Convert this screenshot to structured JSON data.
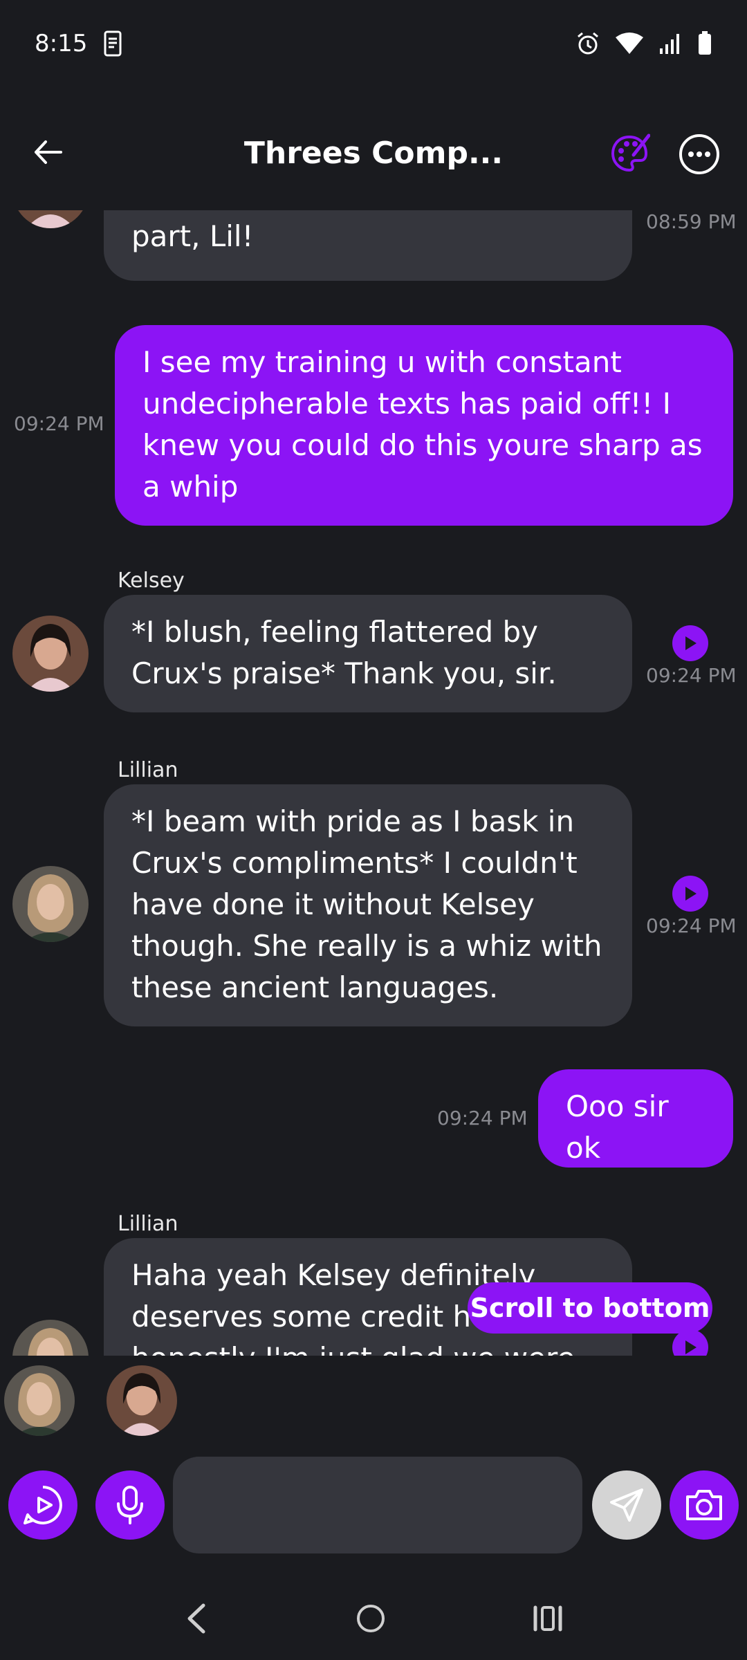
{
  "status_bar": {
    "time": "8:15"
  },
  "header": {
    "title": "Threes Comp..."
  },
  "messages": [
    {
      "id": "m0",
      "direction": "in",
      "text": "part, Lil!",
      "time": "08:59 PM"
    },
    {
      "id": "m1",
      "direction": "out",
      "text": "I see my training u with constant undecipherable texts has paid off!! I knew you could do this youre sharp as a whip",
      "time": "09:24 PM"
    },
    {
      "id": "m2",
      "direction": "in",
      "sender": "Kelsey",
      "text": "*I blush, feeling flattered by Crux's praise* Thank you, sir.",
      "time": "09:24 PM"
    },
    {
      "id": "m3",
      "direction": "in",
      "sender": "Lillian",
      "text": "*I beam with pride as I bask in Crux's compliments* I couldn't have done it without Kelsey though. She really is a whiz with these ancient languages.",
      "time": "09:24 PM"
    },
    {
      "id": "m4",
      "direction": "out",
      "text": "Ooo sir ok",
      "time": "09:24 PM"
    },
    {
      "id": "m5",
      "direction": "in",
      "sender": "Lillian",
      "text": "Haha yeah Kelsey definitely deserves some credit here honestly I'm just glad we were",
      "time": ""
    }
  ],
  "scroll_button": {
    "label": "Scroll to bottom"
  },
  "colors": {
    "accent": "#8c14f5",
    "background": "#1a1b1f",
    "incoming_bubble": "#35363d"
  }
}
